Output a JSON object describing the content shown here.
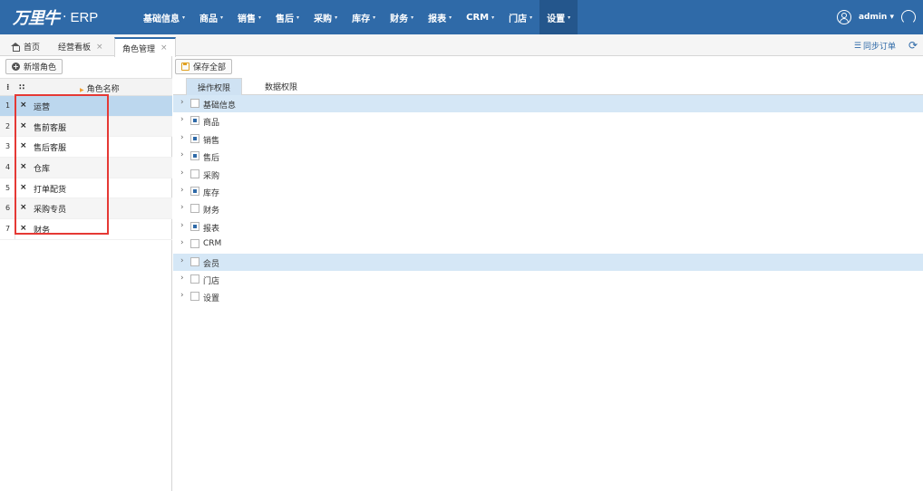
{
  "header": {
    "logo_brand": "万里牛",
    "logo_dot": "·",
    "logo_erp": "ERP",
    "nav": [
      {
        "label": "基础信息",
        "active": false
      },
      {
        "label": "商品",
        "active": false
      },
      {
        "label": "销售",
        "active": false
      },
      {
        "label": "售后",
        "active": false
      },
      {
        "label": "采购",
        "active": false
      },
      {
        "label": "库存",
        "active": false
      },
      {
        "label": "财务",
        "active": false
      },
      {
        "label": "报表",
        "active": false
      },
      {
        "label": "CRM",
        "active": false
      },
      {
        "label": "门店",
        "active": false
      },
      {
        "label": "设置",
        "active": true
      }
    ],
    "user": "admin",
    "caret": "▾"
  },
  "tabs": [
    {
      "label": "首页",
      "closable": false,
      "active": false
    },
    {
      "label": "经营看板",
      "closable": true,
      "active": false
    },
    {
      "label": "角色管理",
      "closable": true,
      "active": true
    }
  ],
  "tab_close_glyph": "×",
  "sync_label": "同步订单",
  "sync_glyph": "☰",
  "refresh_glyph": "⟳",
  "left": {
    "add_role_label": "新增角色",
    "col_header": "角色名称",
    "roles": [
      {
        "num": "1",
        "name": "运营",
        "selected": true
      },
      {
        "num": "2",
        "name": "售前客服",
        "selected": false
      },
      {
        "num": "3",
        "name": "售后客服",
        "selected": false
      },
      {
        "num": "4",
        "name": "仓库",
        "selected": false
      },
      {
        "num": "5",
        "name": "打单配货",
        "selected": false
      },
      {
        "num": "6",
        "name": "采购专员",
        "selected": false
      },
      {
        "num": "7",
        "name": "财务",
        "selected": false
      }
    ],
    "delete_glyph": "×"
  },
  "right": {
    "save_all_label": "保存全部",
    "perm_tabs": [
      {
        "label": "操作权限",
        "active": true
      },
      {
        "label": "数据权限",
        "active": false
      }
    ],
    "tree": [
      {
        "label": "基础信息",
        "state": "unchecked",
        "highlight": true
      },
      {
        "label": "商品",
        "state": "partial",
        "highlight": false
      },
      {
        "label": "销售",
        "state": "partial",
        "highlight": false
      },
      {
        "label": "售后",
        "state": "partial",
        "highlight": false
      },
      {
        "label": "采购",
        "state": "unchecked",
        "highlight": false
      },
      {
        "label": "库存",
        "state": "partial",
        "highlight": false
      },
      {
        "label": "财务",
        "state": "unchecked",
        "highlight": false
      },
      {
        "label": "报表",
        "state": "partial",
        "highlight": false
      },
      {
        "label": "CRM",
        "state": "unchecked",
        "highlight": false
      },
      {
        "label": "会员",
        "state": "unchecked",
        "highlight": true
      },
      {
        "label": "门店",
        "state": "unchecked",
        "highlight": false
      },
      {
        "label": "设置",
        "state": "unchecked",
        "highlight": false
      }
    ],
    "chevron_glyph": "›"
  },
  "colors": {
    "header_bg": "#2f6aa8",
    "selected_row": "#bcd7ee",
    "highlight_box": "#e53935",
    "tree_highlight": "#d5e7f6"
  }
}
